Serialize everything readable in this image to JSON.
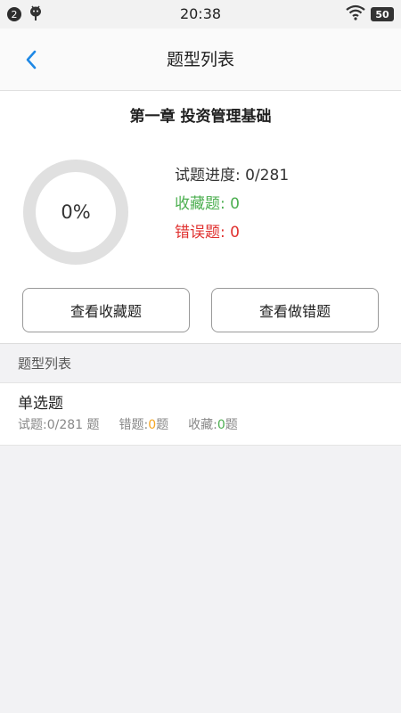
{
  "status_bar": {
    "notification_count": "2",
    "time": "20:38",
    "battery": "50"
  },
  "nav": {
    "title": "题型列表"
  },
  "summary": {
    "chapter_title": "第一章 投资管理基础",
    "progress_percent_label": "0%",
    "progress_fraction": 0,
    "progress_label": "试题进度: ",
    "progress_value": "0/281",
    "favorites_label": "收藏题: ",
    "favorites_value": "0",
    "wrong_label": "错误题: ",
    "wrong_value": "0",
    "view_favorites_button": "查看收藏题",
    "view_wrong_button": "查看做错题"
  },
  "section": {
    "header": "题型列表"
  },
  "question_types": [
    {
      "title": "单选题",
      "questions_text": "试题:0/281 题",
      "wrong_label": "错题:",
      "wrong_value": "0",
      "wrong_suffix": "题",
      "fav_label": "收藏:",
      "fav_value": "0",
      "fav_suffix": "题"
    }
  ],
  "colors": {
    "accent_blue": "#1e88e5",
    "favorites_green": "#4caf50",
    "wrong_red": "#e0312f",
    "wrong_count_orange": "#f5a623",
    "ring_gray": "#e0e0e0"
  }
}
